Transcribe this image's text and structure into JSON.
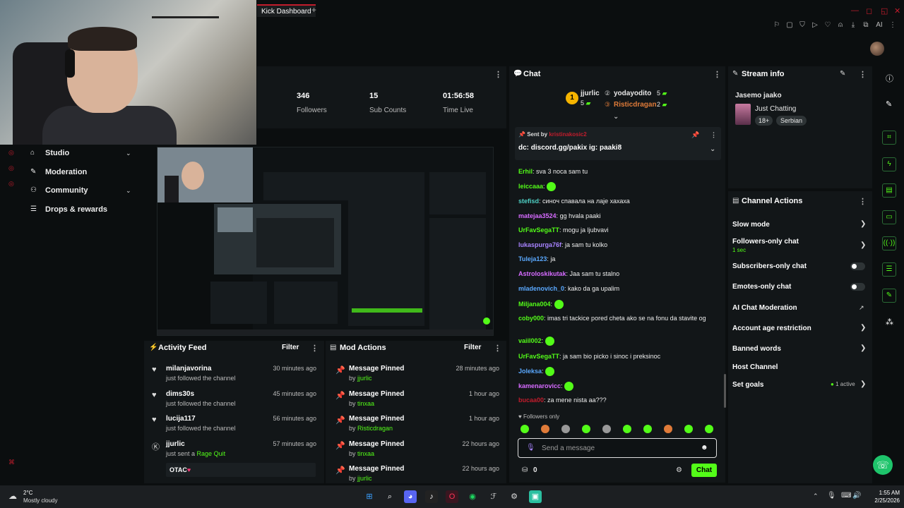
{
  "browser": {
    "tab_title": "Kick Dashboard",
    "new_tab": "+",
    "profile": "AI"
  },
  "stats": [
    {
      "value": "346",
      "label": "Followers"
    },
    {
      "value": "15",
      "label": "Sub Counts"
    },
    {
      "value": "01:56:58",
      "label": "Time Live"
    }
  ],
  "sidebar": {
    "items": [
      {
        "label": "Studio",
        "icon": "home-icon",
        "expandable": true
      },
      {
        "label": "Moderation",
        "icon": "wrench-icon",
        "expandable": false
      },
      {
        "label": "Community",
        "icon": "people-icon",
        "expandable": true
      },
      {
        "label": "Drops & rewards",
        "icon": "list-icon",
        "expandable": false
      }
    ]
  },
  "activity_feed": {
    "title": "Activity Feed",
    "filter": "Filter",
    "items": [
      {
        "name": "milanjavorina",
        "text": "just followed the channel",
        "time": "30 minutes ago"
      },
      {
        "name": "dims30s",
        "text": "just followed the channel",
        "time": "45 minutes ago"
      },
      {
        "name": "lucija117",
        "text": "just followed the channel",
        "time": "56 minutes ago"
      },
      {
        "name": "jjurlic",
        "text": "just sent a",
        "highlight": "Rage Quit",
        "time": "57 minutes ago",
        "extra": "OTAC"
      }
    ]
  },
  "mod_actions": {
    "title": "Mod Actions",
    "filter": "Filter",
    "items": [
      {
        "action": "Message Pinned",
        "by_prefix": "by",
        "by": "jjurlic",
        "time": "28 minutes ago"
      },
      {
        "action": "Message Pinned",
        "by_prefix": "by",
        "by": "tinxaa",
        "time": "1 hour ago"
      },
      {
        "action": "Message Pinned",
        "by_prefix": "by",
        "by": "Risticdragan",
        "time": "1 hour ago"
      },
      {
        "action": "Message Pinned",
        "by_prefix": "by",
        "by": "tinxaa",
        "time": "22 hours ago"
      },
      {
        "action": "Message Pinned",
        "by_prefix": "by",
        "by": "jjurlic",
        "time": "22 hours ago"
      }
    ]
  },
  "chat": {
    "title": "Chat",
    "top_gifters": [
      {
        "name": "jjurlic",
        "count": "5"
      },
      {
        "name": "yodayodito",
        "count": "5"
      },
      {
        "name": "Risticdragan",
        "count": "2"
      }
    ],
    "pinned": {
      "sent_by": "Sent by",
      "author": "kristinakosic2",
      "text": "dc: discord.gg/pakix ig: paaki8"
    },
    "messages": [
      {
        "user": "Erhil",
        "color": "#53fc18",
        "text": "sva 3 noca sam tu"
      },
      {
        "user": "leiccaaa",
        "color": "#53fc18",
        "text": ""
      },
      {
        "user": "stefisd",
        "color": "#4fd1c5",
        "text": "синоч спавала на лаје хахаха"
      },
      {
        "user": "matejaa3524",
        "color": "#d66bff",
        "text": "gg hvala paaki"
      },
      {
        "user": "UrFavSegaTT",
        "color": "#53fc18",
        "text": "mogu ja ljubvavi"
      },
      {
        "user": "lukaspurga76f",
        "color": "#a883ff",
        "text": "ja sam tu kolko"
      },
      {
        "user": "Tuleja123",
        "color": "#5aa9ff",
        "text": "ja"
      },
      {
        "user": "Astroloskikutak",
        "color": "#d66bff",
        "text": "Jaa sam tu stalno"
      },
      {
        "user": "mladenovich_0",
        "color": "#5aa9ff",
        "text": "kako da ga upalim"
      },
      {
        "user": "Miljana004",
        "color": "#53fc18",
        "text": ""
      },
      {
        "user": "coby000",
        "color": "#53fc18",
        "text": "imas tri tackice pored cheta ako se na fonu da stavite og"
      },
      {
        "user": "vaiil002",
        "color": "#53fc18",
        "text": ""
      },
      {
        "user": "UrFavSegaTT",
        "color": "#53fc18",
        "text": "ja sam bio picko i sinoc i preksinoc"
      },
      {
        "user": "Joleksa",
        "color": "#5aa9ff",
        "text": ""
      },
      {
        "user": "kamenarovicc",
        "color": "#d66bff",
        "text": ""
      },
      {
        "user": "bucaa00",
        "color": "#c21c2c",
        "text": "za mene nista aa???"
      }
    ],
    "mode": "Followers only",
    "input_placeholder": "Send a message",
    "points": "0",
    "send_label": "Chat"
  },
  "stream_info": {
    "title": "Stream info",
    "stream_title": "Jasemo jaako",
    "category": "Just Chatting",
    "tags": [
      "18+",
      "Serbian"
    ]
  },
  "channel_actions": {
    "title": "Channel Actions",
    "items": [
      {
        "label": "Slow mode",
        "control": "chevron"
      },
      {
        "label": "Followers-only chat",
        "sub": "1 sec",
        "control": "chevron"
      },
      {
        "label": "Subscribers-only chat",
        "control": "toggle"
      },
      {
        "label": "Emotes-only chat",
        "control": "toggle"
      },
      {
        "label": "AI Chat Moderation",
        "control": "external"
      },
      {
        "label": "Account age restriction",
        "control": "chevron"
      },
      {
        "label": "Banned words",
        "control": "chevron"
      },
      {
        "label": "Host Channel",
        "control": "none"
      },
      {
        "label": "Set goals",
        "badge": "1 active",
        "control": "chevron"
      }
    ]
  },
  "taskbar": {
    "weather_temp": "2°C",
    "weather_desc": "Mostly cloudy",
    "time": "1:55 AM",
    "date": "2/25/2026"
  },
  "colors": {
    "accent": "#53fc18",
    "brand_red": "#c21c2c",
    "panel": "#121618",
    "background": "#0b0e0f"
  }
}
